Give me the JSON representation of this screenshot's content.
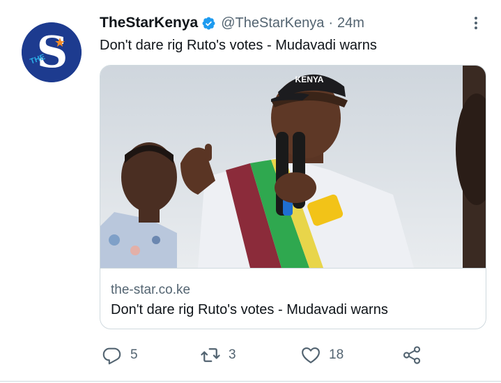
{
  "tweet": {
    "account": {
      "display_name": "TheStarKenya",
      "handle": "@TheStarKenya",
      "separator": "·",
      "time": "24m",
      "verified": true,
      "avatar_logo_letters": "THE S"
    },
    "text": "Don't dare rig Ruto's votes - Mudavadi warns",
    "card": {
      "domain": "the-star.co.ke",
      "title": "Don't dare rig Ruto's votes - Mudavadi warns",
      "image_caption_text": "KENYA"
    },
    "actions": {
      "reply_count": "5",
      "retweet_count": "3",
      "like_count": "18"
    }
  },
  "icons": {
    "verified": "verified-badge-icon",
    "more": "more-vertical-icon",
    "reply": "reply-icon",
    "retweet": "retweet-icon",
    "like": "heart-icon",
    "share": "share-icon"
  },
  "colors": {
    "accent": "#1d9bf0",
    "text_primary": "#0f1419",
    "text_secondary": "#536471",
    "border": "#cfd9de",
    "avatar_bg": "#1d3b8f"
  }
}
